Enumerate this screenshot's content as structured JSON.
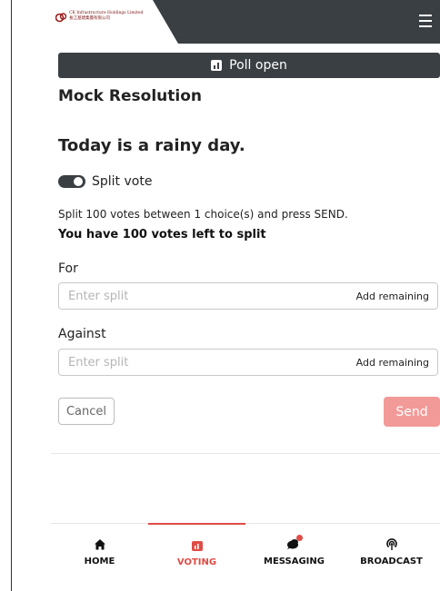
{
  "header": {
    "logo": {
      "company_en": "CK Infrastructure Holdings Limited",
      "company_zh": "長江基建集團有限公司",
      "icon": "ck-logo-icon"
    },
    "menu_icon": "hamburger-menu-icon"
  },
  "poll_status": {
    "label": "Poll open",
    "icon": "bar-chart-icon"
  },
  "resolution": {
    "title": "Mock Resolution",
    "question": "Today is a rainy day."
  },
  "split_vote": {
    "label": "Split vote",
    "enabled": true
  },
  "instructions": {
    "text": "Split 100 votes between 1 choice(s) and press SEND.",
    "votes_left": "You have 100 votes left to split"
  },
  "choices": [
    {
      "label": "For",
      "value": "",
      "placeholder": "Enter split",
      "action_label": "Add remaining"
    },
    {
      "label": "Against",
      "value": "",
      "placeholder": "Enter split",
      "action_label": "Add remaining"
    }
  ],
  "actions": {
    "cancel_label": "Cancel",
    "send_label": "Send"
  },
  "nav": {
    "items": [
      {
        "label": "HOME",
        "icon": "home-icon",
        "active": false
      },
      {
        "label": "VOTING",
        "icon": "voting-icon",
        "active": true
      },
      {
        "label": "MESSAGING",
        "icon": "messaging-icon",
        "active": false
      },
      {
        "label": "BROADCAST",
        "icon": "broadcast-icon",
        "active": false
      }
    ]
  },
  "colors": {
    "header_bg": "#3a3f43",
    "accent": "#e14b46",
    "send_disabled": "#f29a98",
    "logo_red": "#7a1010"
  }
}
